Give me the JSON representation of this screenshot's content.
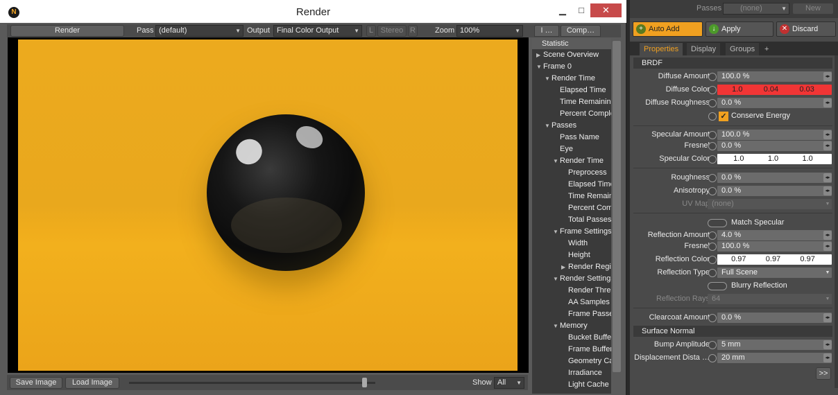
{
  "window": {
    "title": "Render",
    "logo": "N",
    "minimize": "▁",
    "maximize": "□",
    "close": "✕"
  },
  "toolbar": {
    "render_label": "Render",
    "pass_label": "Pass",
    "pass_value": "(default)",
    "output_label": "Output",
    "output_value": "Final Color Output",
    "stereo_l": "L",
    "stereo_label": "Stereo",
    "stereo_r": "R",
    "zoom_label": "Zoom",
    "zoom_value": "100%",
    "tab_info": "I …",
    "tab_comp": "Comp…"
  },
  "statusbar": {
    "save_label": "Save Image",
    "load_label": "Load Image",
    "show_label": "Show",
    "show_value": "All"
  },
  "stats": {
    "header": "Statistic",
    "rows": [
      {
        "indent": 0,
        "twisty": "▶",
        "label": "Scene Overview"
      },
      {
        "indent": 0,
        "twisty": "▼",
        "label": "Frame 0"
      },
      {
        "indent": 1,
        "twisty": "▼",
        "label": "Render Time"
      },
      {
        "indent": 2,
        "twisty": "",
        "label": "Elapsed Time"
      },
      {
        "indent": 2,
        "twisty": "",
        "label": "Time Remaining"
      },
      {
        "indent": 2,
        "twisty": "",
        "label": "Percent Complete"
      },
      {
        "indent": 1,
        "twisty": "▼",
        "label": "Passes"
      },
      {
        "indent": 2,
        "twisty": "",
        "label": "Pass Name"
      },
      {
        "indent": 2,
        "twisty": "",
        "label": "Eye"
      },
      {
        "indent": 2,
        "twisty": "▼",
        "label": "Render Time"
      },
      {
        "indent": 3,
        "twisty": "",
        "label": "Preprocess"
      },
      {
        "indent": 3,
        "twisty": "",
        "label": "Elapsed Time"
      },
      {
        "indent": 3,
        "twisty": "",
        "label": "Time Remaining"
      },
      {
        "indent": 3,
        "twisty": "",
        "label": "Percent Complete"
      },
      {
        "indent": 3,
        "twisty": "",
        "label": "Total Passes"
      },
      {
        "indent": 2,
        "twisty": "▼",
        "label": "Frame Settings"
      },
      {
        "indent": 3,
        "twisty": "",
        "label": "Width"
      },
      {
        "indent": 3,
        "twisty": "",
        "label": "Height"
      },
      {
        "indent": 3,
        "twisty": "▶",
        "label": "Render Region"
      },
      {
        "indent": 2,
        "twisty": "▼",
        "label": "Render Settings"
      },
      {
        "indent": 3,
        "twisty": "",
        "label": "Render Threads"
      },
      {
        "indent": 3,
        "twisty": "",
        "label": "AA Samples"
      },
      {
        "indent": 3,
        "twisty": "",
        "label": "Frame Passes"
      },
      {
        "indent": 2,
        "twisty": "▼",
        "label": "Memory"
      },
      {
        "indent": 3,
        "twisty": "",
        "label": "Bucket Buffers"
      },
      {
        "indent": 3,
        "twisty": "",
        "label": "Frame Buffers"
      },
      {
        "indent": 3,
        "twisty": "",
        "label": "Geometry Cache"
      },
      {
        "indent": 3,
        "twisty": "",
        "label": "Irradiance"
      },
      {
        "indent": 3,
        "twisty": "",
        "label": "Light Cache"
      }
    ]
  },
  "props_top": {
    "passes_label": "Passes",
    "passes_value": "(none)",
    "new_label": "New"
  },
  "actions": {
    "auto_add": "Auto Add",
    "apply": "Apply",
    "discard": "Discard"
  },
  "tabs": {
    "properties": "Properties",
    "display": "Display",
    "groups": "Groups",
    "add": "+"
  },
  "sections": {
    "brdf": "BRDF",
    "surface_normal": "Surface Normal"
  },
  "props": {
    "diffuse_amount": {
      "label": "Diffuse Amount",
      "value": "100.0 %"
    },
    "diffuse_color": {
      "label": "Diffuse Color",
      "r": "1.0",
      "g": "0.04",
      "b": "0.03"
    },
    "diffuse_roughness": {
      "label": "Diffuse Roughness",
      "value": "0.0 %"
    },
    "conserve_energy": {
      "label": "Conserve Energy",
      "checked": true
    },
    "specular_amount": {
      "label": "Specular Amount",
      "value": "100.0 %"
    },
    "spec_fresnel": {
      "label": "Fresnel",
      "value": "0.0 %"
    },
    "specular_color": {
      "label": "Specular Color",
      "r": "1.0",
      "g": "1.0",
      "b": "1.0"
    },
    "roughness": {
      "label": "Roughness",
      "value": "0.0 %"
    },
    "anisotropy": {
      "label": "Anisotropy",
      "value": "0.0 %"
    },
    "uv_map": {
      "label": "UV Map",
      "value": "(none)"
    },
    "match_specular": {
      "label": "Match Specular"
    },
    "reflection_amount": {
      "label": "Reflection Amount",
      "value": "4.0 %"
    },
    "refl_fresnel": {
      "label": "Fresnel",
      "value": "100.0 %"
    },
    "reflection_color": {
      "label": "Reflection Color",
      "r": "0.97",
      "g": "0.97",
      "b": "0.97"
    },
    "reflection_type": {
      "label": "Reflection Type",
      "value": "Full Scene"
    },
    "blurry_reflection": {
      "label": "Blurry Reflection"
    },
    "reflection_rays": {
      "label": "Reflection Rays",
      "value": "64"
    },
    "clearcoat_amount": {
      "label": "Clearcoat Amount",
      "value": "0.0 %"
    },
    "bump_amplitude": {
      "label": "Bump Amplitude",
      "value": "5 mm"
    },
    "displacement_distance": {
      "label": "Displacement Dista …",
      "value": "20 mm"
    },
    "more_button": ">>"
  },
  "colors": {
    "accent": "#f0a020",
    "diffuse_swatch": "#f13535",
    "close_button": "#c74a4a"
  }
}
